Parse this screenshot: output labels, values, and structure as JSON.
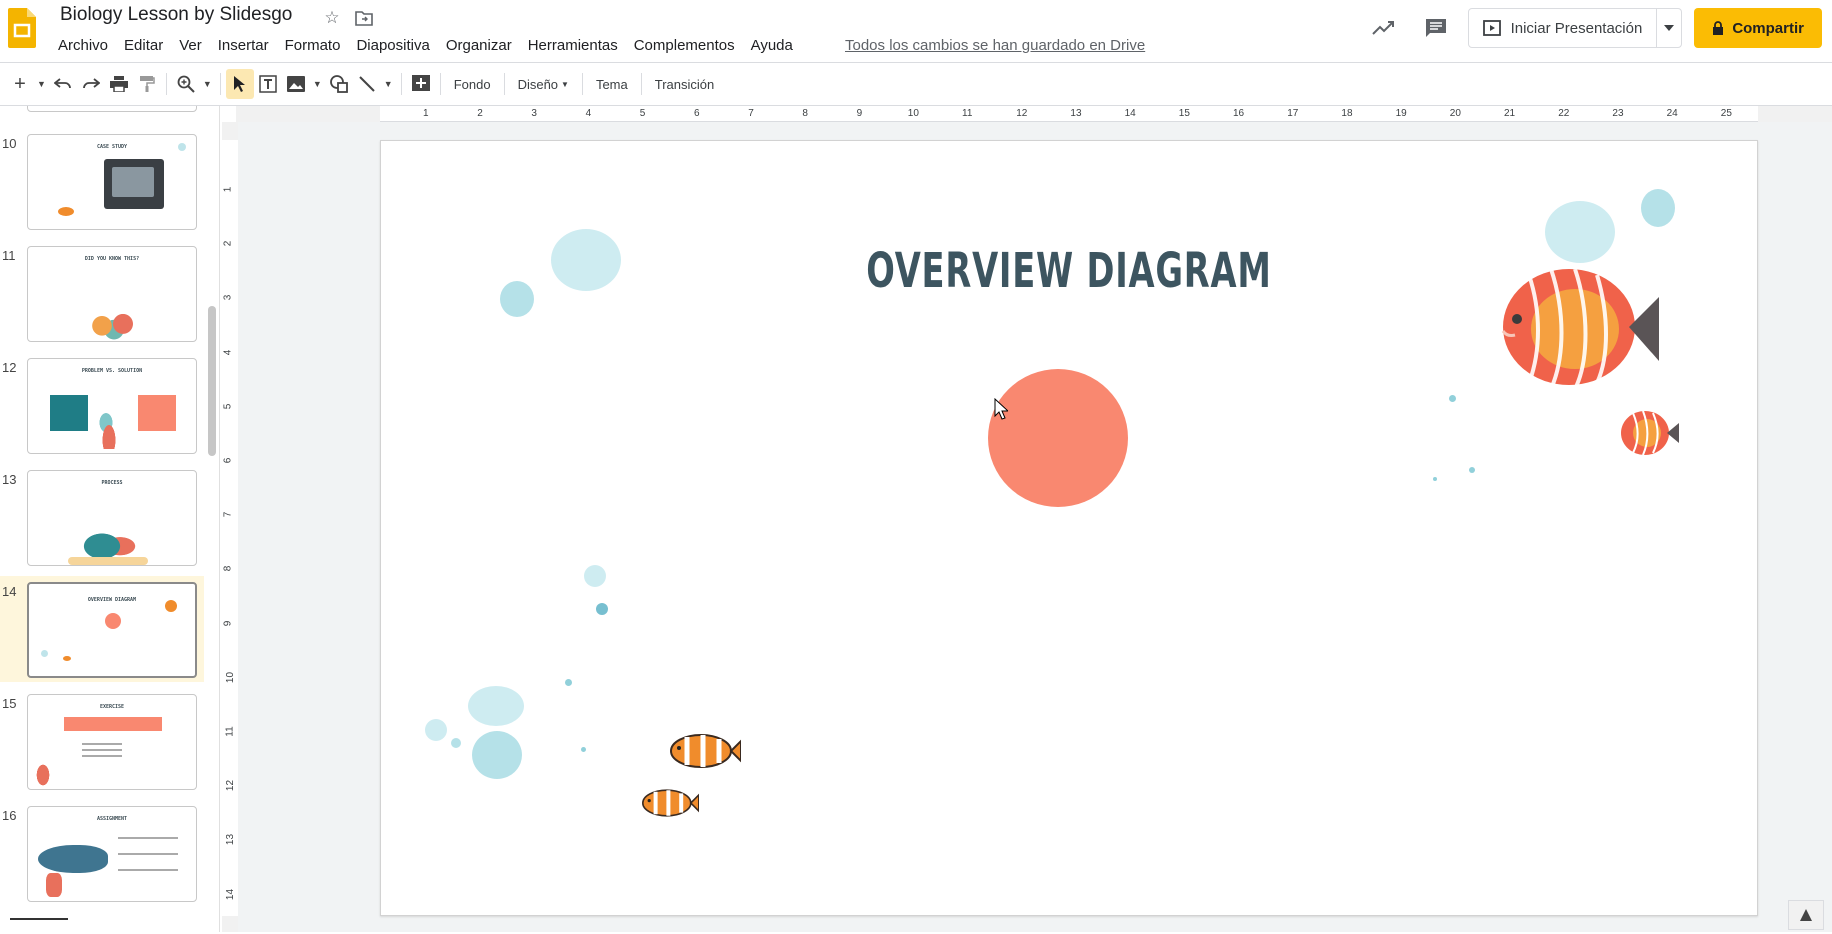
{
  "app": {
    "title": "Biology Lesson by Slidesgo",
    "menu": [
      "Archivo",
      "Editar",
      "Ver",
      "Insertar",
      "Formato",
      "Diapositiva",
      "Organizar",
      "Herramientas",
      "Complementos",
      "Ayuda"
    ],
    "saved_status": "Todos los cambios se han guardado en Drive",
    "present_label": "Iniciar Presentación",
    "share_label": "Compartir"
  },
  "toolbar": {
    "background_label": "Fondo",
    "layout_label": "Diseño",
    "theme_label": "Tema",
    "transition_label": "Transición"
  },
  "filmstrip": {
    "slides": [
      {
        "number": "10",
        "title": "CASE STUDY"
      },
      {
        "number": "11",
        "title": "DID YOU KNOW THIS?"
      },
      {
        "number": "12",
        "title": "PROBLEM VS. SOLUTION"
      },
      {
        "number": "13",
        "title": "PROCESS"
      },
      {
        "number": "14",
        "title": "OVERVIEW DIAGRAM"
      },
      {
        "number": "15",
        "title": "EXERCISE"
      },
      {
        "number": "16",
        "title": "ASSIGNMENT"
      }
    ]
  },
  "rulers": {
    "horizontal": [
      "1",
      "2",
      "3",
      "4",
      "5",
      "6",
      "7",
      "8",
      "9",
      "10",
      "11",
      "12",
      "13",
      "14",
      "15",
      "16",
      "17",
      "18",
      "19",
      "20",
      "21",
      "22",
      "23",
      "24",
      "25"
    ],
    "vertical": [
      "1",
      "2",
      "3",
      "4",
      "5",
      "6",
      "7",
      "8",
      "9",
      "10",
      "11",
      "12",
      "13",
      "14"
    ]
  },
  "slide": {
    "title": "OVERVIEW DIAGRAM"
  },
  "colors": {
    "accent_yellow": "#fbbc04",
    "circle": "#f98870",
    "title": "#3d5560",
    "selected_slide": "#fef6dc"
  }
}
